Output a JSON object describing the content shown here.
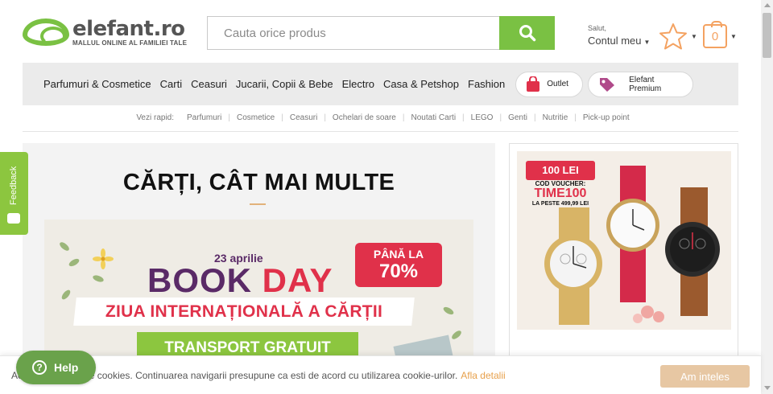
{
  "header": {
    "logo_name": "elefant.ro",
    "logo_tagline": "MALLUL ONLINE AL FAMILIEI TALE",
    "search_placeholder": "Cauta orice produs",
    "account_greeting": "Salut,",
    "account_label": "Contul meu",
    "cart_count": "0",
    "brand_color": "#7ac143",
    "accent_color": "#f4a261"
  },
  "nav": {
    "items": [
      "Parfumuri & Cosmetice",
      "Carti",
      "Ceasuri",
      "Jucarii, Copii & Bebe",
      "Electro",
      "Casa & Petshop",
      "Fashion"
    ],
    "outlet_label": "Outlet",
    "premium_line1": "Elefant",
    "premium_line2": "Premium"
  },
  "quick": {
    "label": "Vezi rapid:",
    "links": [
      "Parfumuri",
      "Cosmetice",
      "Ceasuri",
      "Ochelari de soare",
      "Noutati Carti",
      "LEGO",
      "Genti",
      "Nutritie",
      "Pick-up point"
    ]
  },
  "main": {
    "title": "CĂRȚI, CÂT MAI MULTE",
    "banner": {
      "date": "23 aprilie",
      "title_book": "BOOK",
      "title_day": "DAY",
      "badge_line1": "PÂNĂ LA",
      "badge_line2": "70%",
      "strip": "ZIUA INTERNAȚIONALĂ  A CĂRȚII",
      "green": "TRANSPORT GRATUIT"
    }
  },
  "side_ad": {
    "voucher_amount": "100 LEI",
    "voucher_label": "COD VOUCHER:",
    "voucher_code": "TIME100",
    "voucher_condition": "LA PESTE 499,99 LEI"
  },
  "feedback": {
    "label": "Feedback"
  },
  "cookie": {
    "text": "Acest site foloseste cookies. Continuarea navigarii presupune ca esti de acord cu utilizarea cookie-urilor.",
    "link": "Afla detalii",
    "button": "Am inteles"
  },
  "help": {
    "label": "Help"
  }
}
